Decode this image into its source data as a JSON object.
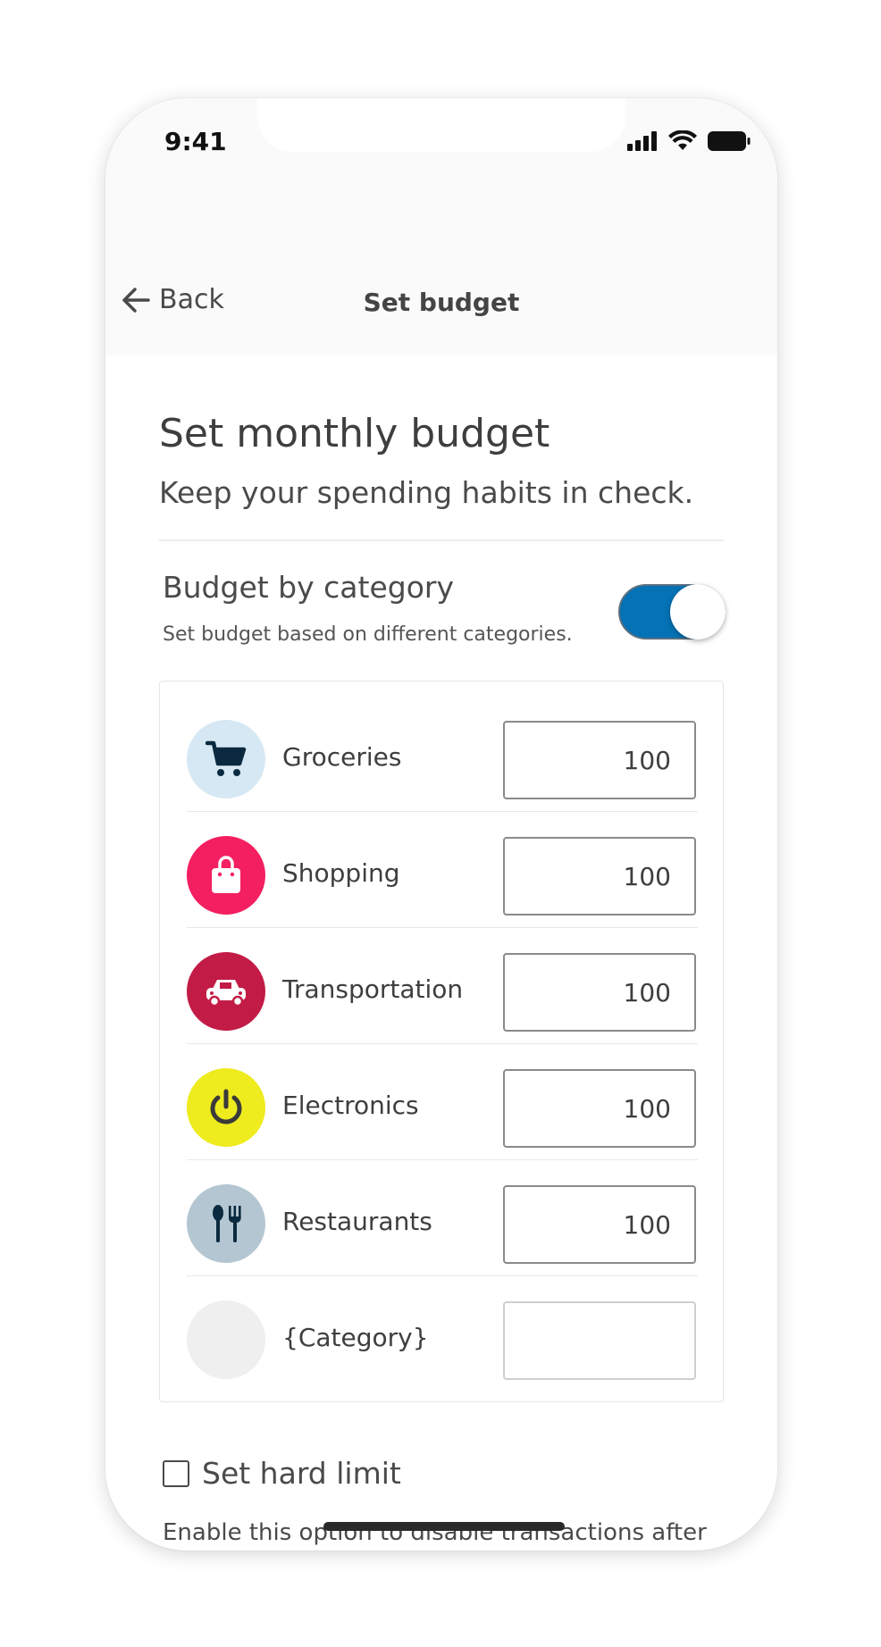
{
  "status_bar": {
    "time": "9:41"
  },
  "navbar": {
    "back_label": "Back",
    "title": "Set budget"
  },
  "page": {
    "title": "Set monthly budget",
    "subtitle": "Keep your spending habits in check."
  },
  "budget_by_category": {
    "title": "Budget by category",
    "description": "Set budget based on different categories.",
    "toggle_on": true
  },
  "categories": [
    {
      "label": "Groceries",
      "value": "100",
      "icon": "cart-icon",
      "color": "#d6e8f3",
      "icon_color": "#0b2a3f"
    },
    {
      "label": "Shopping",
      "value": "100",
      "icon": "shopping-bag-icon",
      "color": "#f41f60",
      "icon_color": "#ffffff"
    },
    {
      "label": "Transportation",
      "value": "100",
      "icon": "car-icon",
      "color": "#c21c46",
      "icon_color": "#ffffff"
    },
    {
      "label": "Electronics",
      "value": "100",
      "icon": "power-icon",
      "color": "#eeeb1e",
      "icon_color": "#3a3a3a"
    },
    {
      "label": "Restaurants",
      "value": "100",
      "icon": "fork-spoon-icon",
      "color": "#b3c6d1",
      "icon_color": "#0b2a3f"
    },
    {
      "label": "{Category}",
      "value": "",
      "icon": "",
      "color": "#efefef",
      "icon_color": ""
    }
  ],
  "hard_limit": {
    "label": "Set hard limit",
    "checked": false,
    "description": "Enable this option to disable transactions after you've exceeded your monthly budget."
  },
  "colors": {
    "accent": "#0472b5"
  }
}
